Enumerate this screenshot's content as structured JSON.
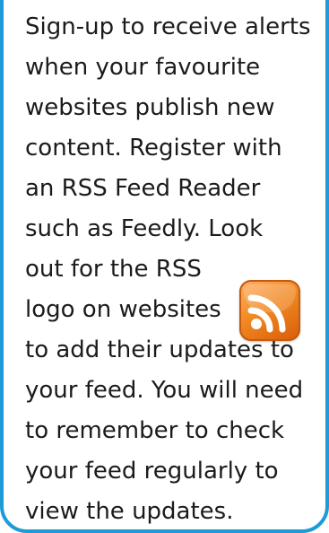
{
  "text": {
    "lines": [
      "Sign-up to receive alerts",
      "when your favourite",
      "websites publish new",
      "content. Register with",
      "an RSS Feed Reader",
      "such as Feedly. Look",
      "out for the RSS",
      "logo on websites",
      "to add their updates to",
      "your feed. You will need",
      "to remember to check",
      "your feed regularly to",
      "view the updates."
    ]
  },
  "icon": {
    "name": "rss-icon"
  },
  "colors": {
    "border": "#1e9ad6",
    "text": "#1b1b1b",
    "rss_orange": "#f08a24"
  }
}
